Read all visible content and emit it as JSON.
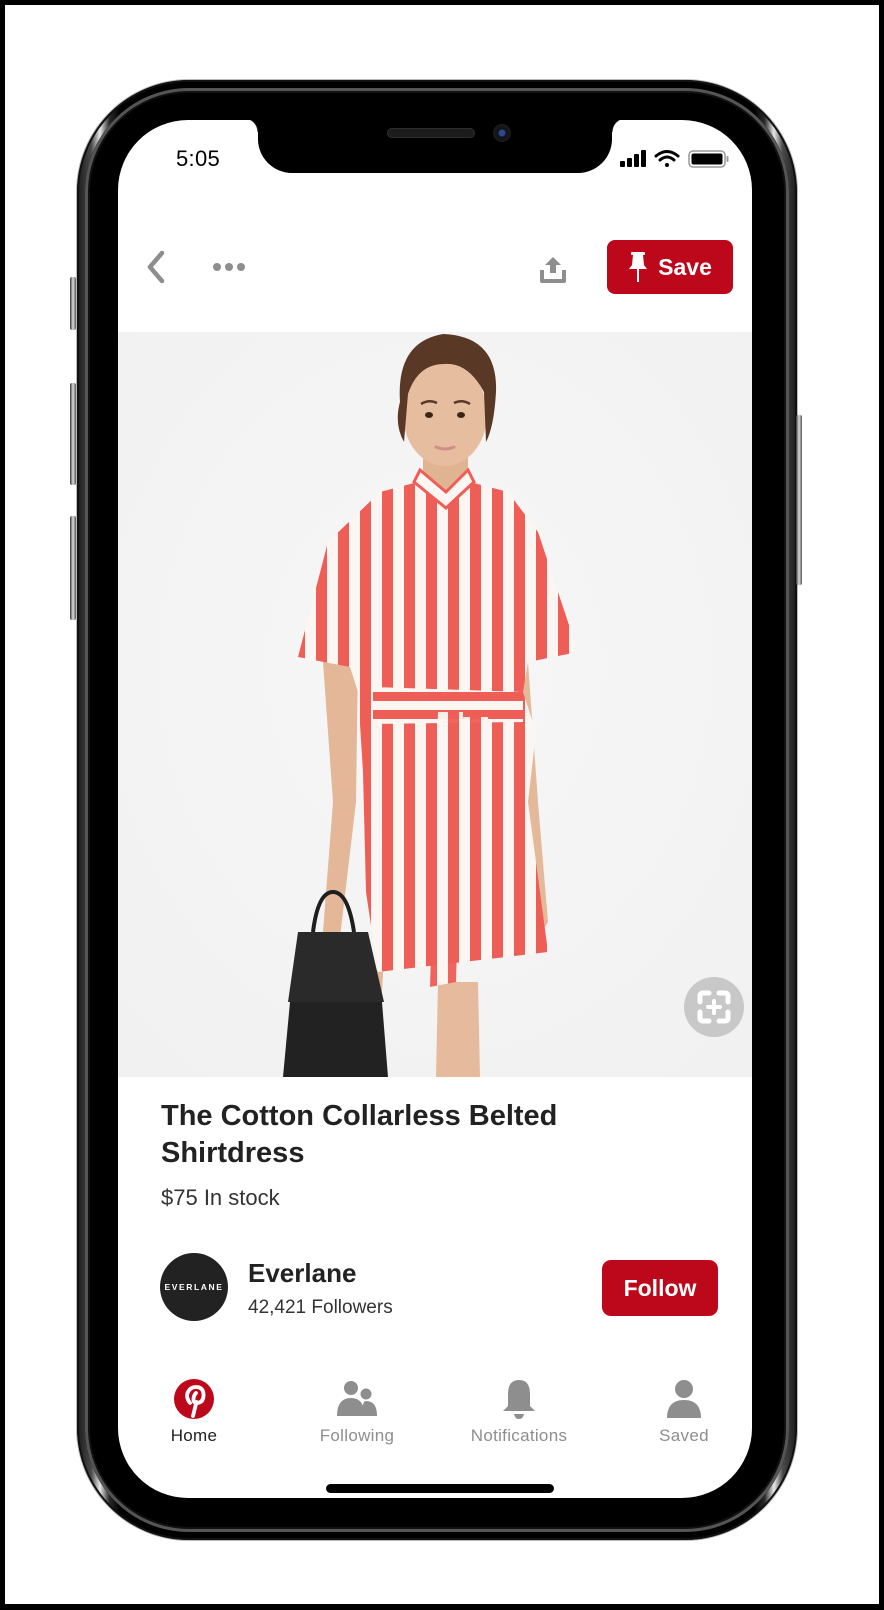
{
  "status_bar": {
    "time": "5:05",
    "icons": [
      "cellular-signal-icon",
      "wifi-icon",
      "battery-icon"
    ]
  },
  "header": {
    "back_icon": "chevron-left-icon",
    "more_icon": "more-horizontal-icon",
    "share_icon": "share-upload-icon",
    "save_button": {
      "label": "Save",
      "icon": "pushpin-icon"
    }
  },
  "pin_image": {
    "description": "Model wearing red and white striped short-sleeve shirtdress with tie belt, holding black tote bag",
    "lens_icon": "visual-search-icon",
    "colors": {
      "background": "#f3f3f3",
      "stripe": "#ef5d57"
    }
  },
  "product": {
    "title": "The Cotton Collarless Belted Shirtdress",
    "price_stock": "$75 In stock"
  },
  "creator": {
    "avatar_text": "EVERLANE",
    "name": "Everlane",
    "followers": "42,421 Followers",
    "follow_label": "Follow"
  },
  "tab_bar": {
    "tabs": [
      {
        "label": "Home",
        "icon": "pinterest-logo-icon",
        "active": true
      },
      {
        "label": "Following",
        "icon": "people-icon",
        "active": false
      },
      {
        "label": "Notifications",
        "icon": "bell-icon",
        "active": false
      },
      {
        "label": "Saved",
        "icon": "person-icon",
        "active": false
      }
    ]
  },
  "colors": {
    "brand_red": "#bd081c",
    "inactive_gray": "#8e8e8e",
    "text_dark": "#222222"
  }
}
